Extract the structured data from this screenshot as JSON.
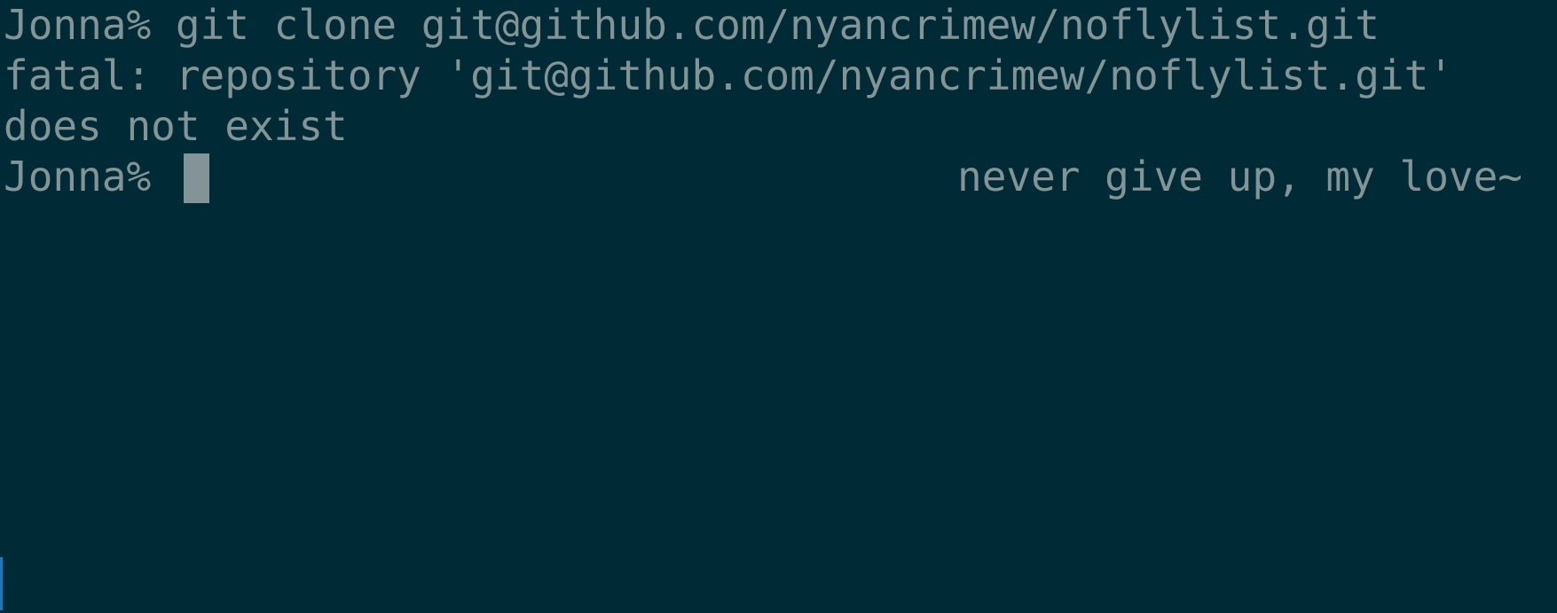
{
  "terminal": {
    "colors": {
      "background": "#002b36",
      "foreground": "#839496",
      "cursor": "#839496",
      "edge_marker": "#268bd2"
    },
    "lines": [
      {
        "prompt": "Jonna%",
        "command": "git clone git@github.com/nyancrimew/noflylist.git"
      },
      {
        "output": "fatal: repository 'git@github.com/nyancrimew/noflylist.git'"
      },
      {
        "output": "does not exist"
      },
      {
        "prompt": "Jonna%",
        "command": ""
      }
    ],
    "right_prompt": "never give up, my love~"
  }
}
